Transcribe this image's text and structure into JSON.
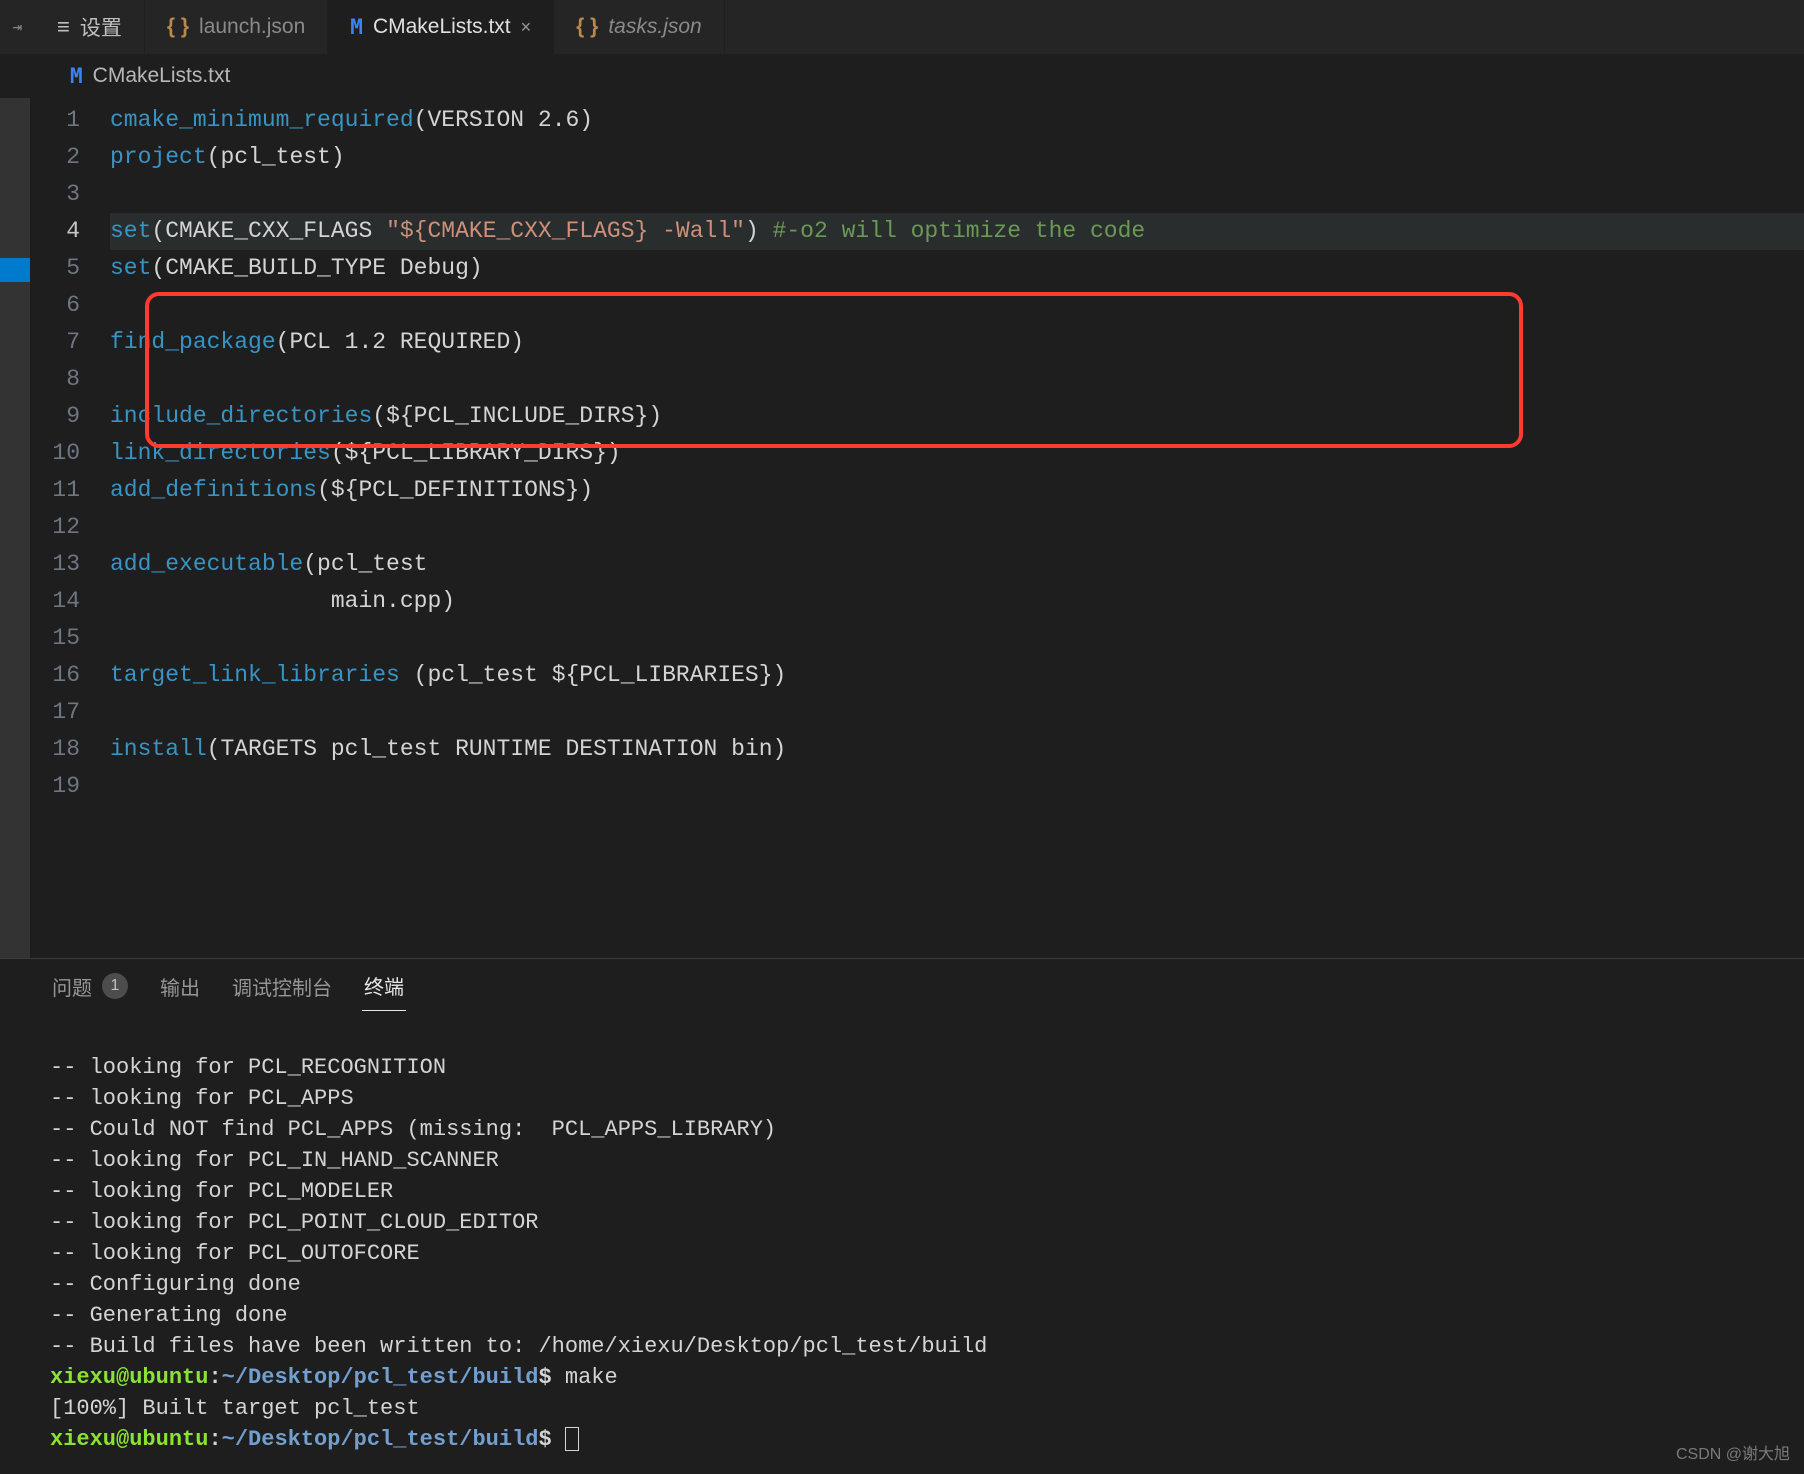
{
  "tabs": {
    "settings": "设置",
    "launch": "launch.json",
    "cmake": "CMakeLists.txt",
    "tasks": "tasks.json",
    "close": "×"
  },
  "breadcrumb": {
    "file": "CMakeLists.txt"
  },
  "lines": [
    "1",
    "2",
    "3",
    "4",
    "5",
    "6",
    "7",
    "8",
    "9",
    "10",
    "11",
    "12",
    "13",
    "14",
    "15",
    "16",
    "17",
    "18",
    "19"
  ],
  "code": {
    "l1": {
      "fn": "cmake_minimum_required",
      "p": "(",
      "arg": "VERSION 2.6",
      "cp": ")"
    },
    "l2": {
      "fn": "project",
      "p": "(",
      "arg": "pcl_test",
      "cp": ")"
    },
    "l4": {
      "fn": "set",
      "p": "(",
      "v": "CMAKE_CXX_FLAGS ",
      "s": "\"${CMAKE_CXX_FLAGS} -Wall\"",
      "cp": ")",
      "cmt": " #-o2 will optimize the code"
    },
    "l5": {
      "fn": "set",
      "p": "(",
      "arg": "CMAKE_BUILD_TYPE Debug",
      "cp": ")"
    },
    "l7": {
      "fn": "find_package",
      "p": "(",
      "arg": "PCL 1.2 REQUIRED",
      "cp": ")"
    },
    "l9": {
      "fn": "include_directories",
      "p": "(",
      "arg": "${PCL_INCLUDE_DIRS}",
      "cp": ")"
    },
    "l10": {
      "fn": "link_directories",
      "p": "(",
      "arg": "${PCL_LIBRARY_DIRS}",
      "cp": ")"
    },
    "l11": {
      "fn": "add_definitions",
      "p": "(",
      "arg": "${PCL_DEFINITIONS}",
      "cp": ")"
    },
    "l13": {
      "fn": "add_executable",
      "p": "(",
      "arg": "pcl_test"
    },
    "l14": {
      "txt": "                main.cpp",
      "cp": ")"
    },
    "l16": {
      "fn": "target_link_libraries ",
      "p": "(",
      "arg": "pcl_test ${PCL_LIBRARIES}",
      "cp": ")"
    },
    "l18": {
      "fn": "install",
      "p": "(",
      "arg": "TARGETS pcl_test RUNTIME DESTINATION bin",
      "cp": ")"
    }
  },
  "panel": {
    "tabs": {
      "problems": "问题",
      "problems_count": "1",
      "output": "输出",
      "debug": "调试控制台",
      "terminal": "终端"
    },
    "lines": [
      "-- looking for PCL_RECOGNITION",
      "-- looking for PCL_APPS",
      "-- Could NOT find PCL_APPS (missing:  PCL_APPS_LIBRARY)",
      "-- looking for PCL_IN_HAND_SCANNER",
      "-- looking for PCL_MODELER",
      "-- looking for PCL_POINT_CLOUD_EDITOR",
      "-- looking for PCL_OUTOFCORE",
      "-- Configuring done",
      "-- Generating done",
      "-- Build files have been written to: /home/xiexu/Desktop/pcl_test/build"
    ],
    "prompt": {
      "user": "xiexu@ubuntu",
      "colon": ":",
      "path": "~/Desktop/pcl_test/build",
      "dollar": "$ "
    },
    "cmd1": "make",
    "built": "[100%] Built target pcl_test"
  },
  "watermark": "CSDN @谢大旭"
}
